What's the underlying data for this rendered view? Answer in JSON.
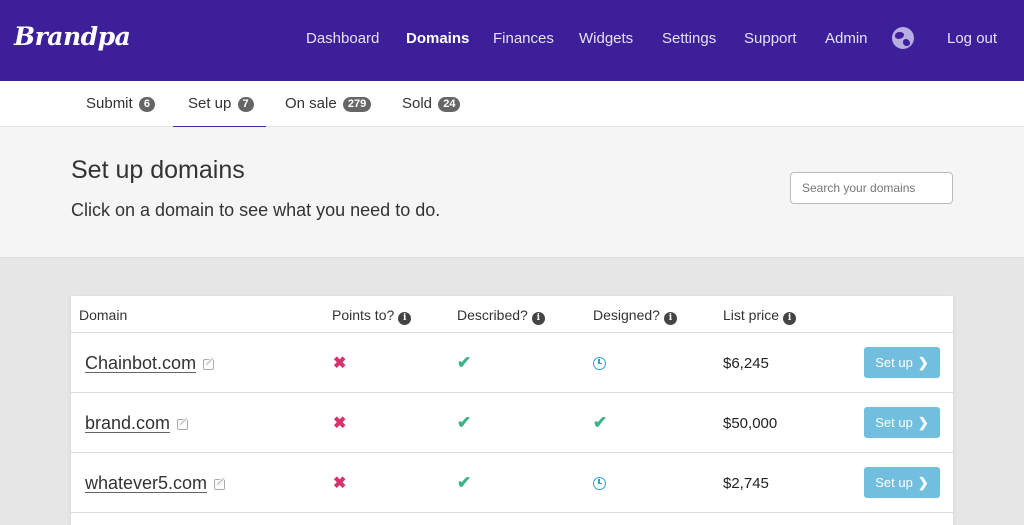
{
  "brand": {
    "logo_text": "Brandpa",
    "header_color": "#3c1f99"
  },
  "nav": {
    "items": [
      {
        "label": "Dashboard",
        "active": false
      },
      {
        "label": "Domains",
        "active": true
      },
      {
        "label": "Finances",
        "active": false
      },
      {
        "label": "Widgets",
        "active": false
      },
      {
        "label": "Settings",
        "active": false
      },
      {
        "label": "Support",
        "active": false
      },
      {
        "label": "Admin",
        "active": false
      }
    ],
    "globe_icon": "globe-icon",
    "logout_label": "Log out"
  },
  "tabs": [
    {
      "label": "Submit",
      "count": "6",
      "active": false
    },
    {
      "label": "Set up",
      "count": "7",
      "active": true
    },
    {
      "label": "On sale",
      "count": "279",
      "active": false
    },
    {
      "label": "Sold",
      "count": "24",
      "active": false
    }
  ],
  "page": {
    "title": "Set up domains",
    "subtitle": "Click on a domain to see what you need to do.",
    "search_placeholder": "Search your domains"
  },
  "table": {
    "headers": {
      "domain": "Domain",
      "points_to": "Points to?",
      "described": "Described?",
      "designed": "Designed?",
      "list_price": "List price"
    },
    "rows": [
      {
        "domain": "Chainbot.com",
        "points_to": "no",
        "described": "yes",
        "designed": "pending",
        "price": "$6,245",
        "action": "Set up"
      },
      {
        "domain": "brand.com",
        "points_to": "no",
        "described": "yes",
        "designed": "yes",
        "price": "$50,000",
        "action": "Set up"
      },
      {
        "domain": "whatever5.com",
        "points_to": "no",
        "described": "yes",
        "designed": "pending",
        "price": "$2,745",
        "action": "Set up"
      }
    ],
    "status_icons": {
      "no": "cross-icon",
      "yes": "check-icon",
      "pending": "clock-icon"
    },
    "status_colors": {
      "no": "#d6336c",
      "yes": "#3fb18a",
      "pending": "#2f9fd8"
    },
    "button_color": "#72bedf"
  }
}
